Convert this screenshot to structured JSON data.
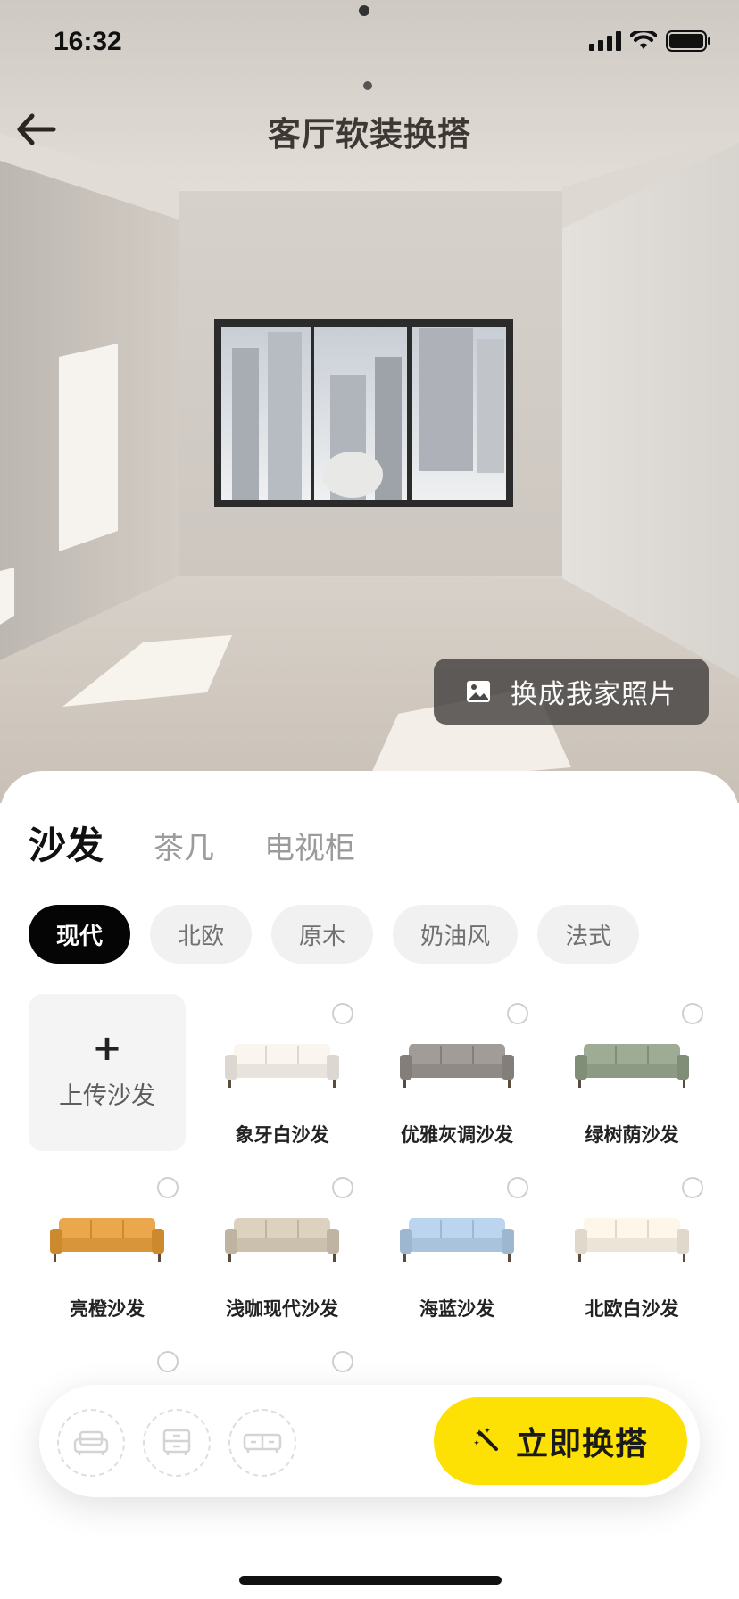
{
  "status_bar": {
    "time": "16:32",
    "icons": [
      "signal-icon",
      "wifi-icon",
      "battery-icon"
    ]
  },
  "nav": {
    "back_icon": "arrow-left-icon",
    "title": "客厅软装换搭"
  },
  "room_preview": {
    "replace_photo": {
      "icon": "image-icon",
      "label": "换成我家照片"
    }
  },
  "sheet": {
    "tabs": [
      {
        "label": "沙发",
        "active": true
      },
      {
        "label": "茶几",
        "active": false
      },
      {
        "label": "电视柜",
        "active": false
      }
    ],
    "style_chips": [
      {
        "label": "现代",
        "active": true
      },
      {
        "label": "北欧",
        "active": false
      },
      {
        "label": "原木",
        "active": false
      },
      {
        "label": "奶油风",
        "active": false
      },
      {
        "label": "法式",
        "active": false
      }
    ],
    "upload": {
      "icon": "plus-icon",
      "plus": "+",
      "label": "上传沙发"
    },
    "products": [
      {
        "name": "象牙白沙发",
        "color": "#e8e3dc"
      },
      {
        "name": "优雅灰调沙发",
        "color": "#8f8a85"
      },
      {
        "name": "绿树荫沙发",
        "color": "#8c9a84"
      },
      {
        "name": "亮橙沙发",
        "color": "#d9953a"
      },
      {
        "name": "浅咖现代沙发",
        "color": "#cbbfae"
      },
      {
        "name": "海蓝沙发",
        "color": "#a9c3dc"
      },
      {
        "name": "北欧白沙发",
        "color": "#ece4d6"
      }
    ]
  },
  "action_bar": {
    "slots": [
      "sofa-slot-icon",
      "coffee-table-slot-icon",
      "tv-cabinet-slot-icon"
    ],
    "go_button": {
      "icon": "magic-wand-icon",
      "label": "立即换搭"
    },
    "accent_color": "#fde004"
  }
}
